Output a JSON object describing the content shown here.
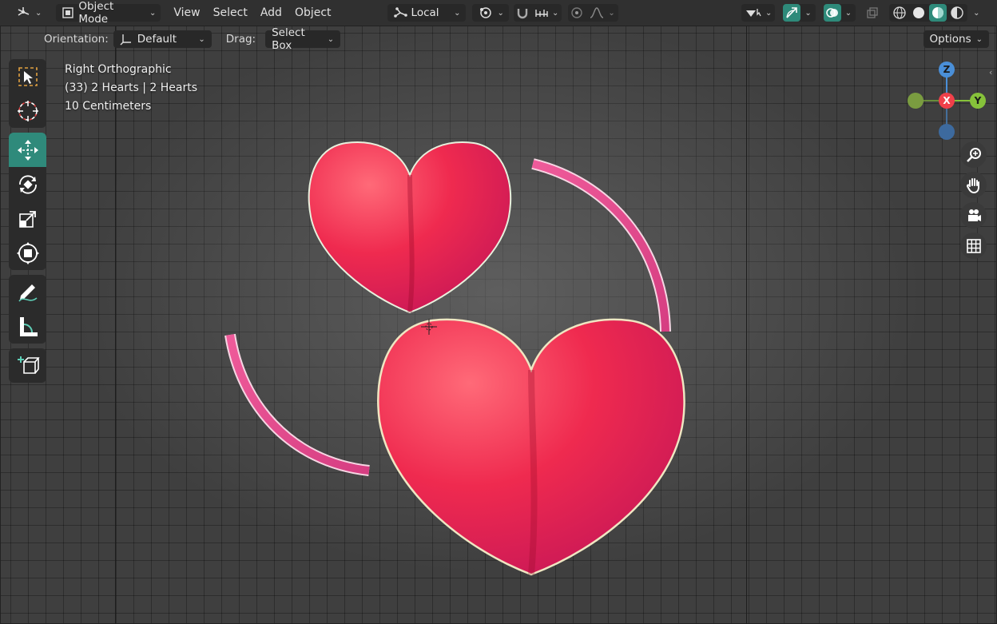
{
  "header": {
    "editor_type_icon": "3d-viewport-icon",
    "mode": "Object Mode",
    "menus": [
      "View",
      "Select",
      "Add",
      "Object"
    ],
    "transform_pivot": "Local",
    "colors": {
      "accent": "#2f8a7b",
      "header_bg": "#303030",
      "viewport_bg": "#3f3f3f"
    }
  },
  "tool_settings": {
    "orientation_label": "Orientation:",
    "orientation_value": "Default",
    "drag_label": "Drag:",
    "drag_value": "Select Box",
    "options_label": "Options"
  },
  "viewport": {
    "view_name": "Right Orthographic",
    "collection_info": "(33) 2 Hearts | 2 Hearts",
    "grid_scale": "10 Centimeters"
  },
  "gizmo": {
    "z": "Z",
    "x": "X",
    "y": "Y"
  },
  "tools": [
    {
      "name": "select-box-tool",
      "icon": "select-box-icon"
    },
    {
      "name": "cursor-tool",
      "icon": "cursor-icon"
    },
    {
      "name": "move-tool",
      "icon": "move-icon",
      "active": true
    },
    {
      "name": "rotate-tool",
      "icon": "rotate-icon"
    },
    {
      "name": "scale-tool",
      "icon": "scale-icon"
    },
    {
      "name": "transform-tool",
      "icon": "transform-icon"
    },
    {
      "name": "annotate-tool",
      "icon": "annotate-icon"
    },
    {
      "name": "measure-tool",
      "icon": "measure-icon"
    },
    {
      "name": "add-cube-tool",
      "icon": "add-cube-icon"
    }
  ]
}
